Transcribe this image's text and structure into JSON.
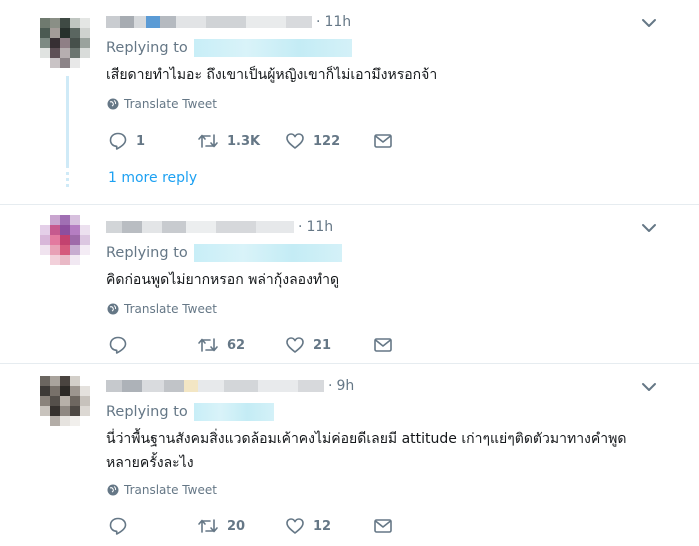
{
  "tweets": [
    {
      "time": "11h",
      "replying_label": "Replying to",
      "text": "เสียดายทำไมอะ ถึงเขาเป็นผู้หญิงเขาก็ไม่เอามึงหรอกจ้า",
      "translate": "Translate Tweet",
      "replies": "1",
      "retweets": "1.3K",
      "likes": "122",
      "more_reply": "1 more reply"
    },
    {
      "time": "11h",
      "replying_label": "Replying to",
      "text": "คิดก่อนพูดไม่ยากหรอก พล่ากุ้งลองทำดู",
      "translate": "Translate Tweet",
      "replies": "",
      "retweets": "62",
      "likes": "21"
    },
    {
      "time": "9h",
      "replying_label": "Replying to",
      "text_line1": "นี่ว่าพื้นฐานสังคมสิ่งแวดล้อมเค้าคงไม่ค่อยดีเลยมี attitude เก่าๆแย่ๆติดตัวมาทางคำพูด",
      "text_line2": "หลายครั้งละไง",
      "translate": "Translate Tweet",
      "replies": "",
      "retweets": "20",
      "likes": "12"
    }
  ],
  "colors": {
    "muted": "#657786",
    "link": "#1da1f2",
    "text": "#14171a",
    "separator": "#e6ecf0"
  }
}
